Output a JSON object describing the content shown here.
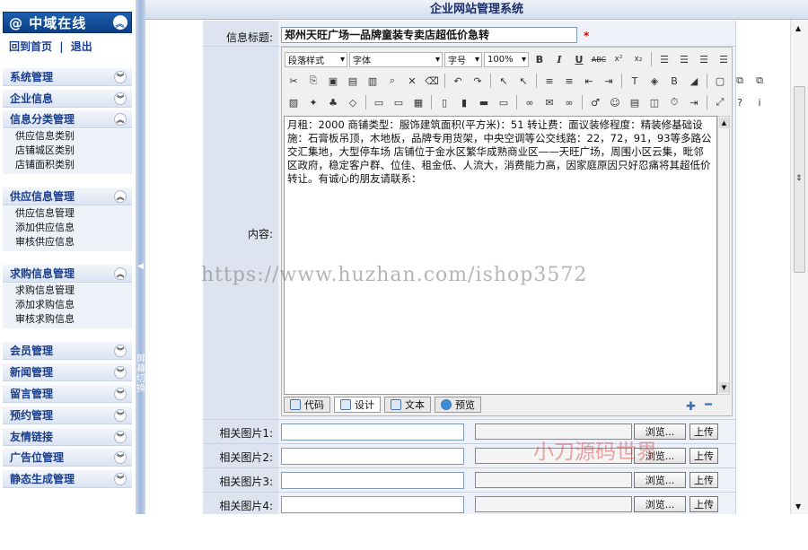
{
  "sidebar": {
    "brand": "@ 中域在线",
    "links": {
      "home": "回到首页",
      "sep": "|",
      "logout": "退出"
    },
    "menus": [
      {
        "label": "系统管理"
      },
      {
        "label": "企业信息"
      },
      {
        "label": "信息分类管理",
        "items": [
          "供应信息类别",
          "店铺城区类别",
          "店铺面积类别"
        ]
      },
      {
        "label": "供应信息管理",
        "items": [
          "供应信息管理",
          "添加供应信息",
          "审核供应信息"
        ]
      },
      {
        "label": "求购信息管理",
        "items": [
          "求购信息管理",
          "添加求购信息",
          "审核求购信息"
        ]
      },
      {
        "label": "会员管理"
      },
      {
        "label": "新闻管理"
      },
      {
        "label": "留言管理"
      },
      {
        "label": "预约管理"
      },
      {
        "label": "友情链接"
      },
      {
        "label": "广告位管理"
      },
      {
        "label": "静态生成管理"
      }
    ],
    "split_text": "屏幕切换"
  },
  "header": {
    "title": "企业网站管理系统"
  },
  "form": {
    "title_label": "信息标题:",
    "title_value": "郑州天旺广场一品牌童装专卖店超低价急转",
    "required_mark": "*",
    "content_label": "内容:",
    "content_text": "月租：2000 商铺类型：服饰建筑面积(平方米)：51 转让费：面议装修程度：精装修基础设施：石膏板吊顶，木地板，品牌专用货架，中央空调等公交线路：22，72，91，93等多路公交汇集地，大型停车场 店铺位于金水区繁华成熟商业区——天旺广场，周围小区云集，毗邻区政府，稳定客户群、位佳、租金低、人流大，消费能力高，因家庭原因只好忍痛将其超低价转让。有诚心的朋友请联系：",
    "toolbar": {
      "paragraph_style": "段落样式",
      "font": "字体",
      "font_size": "字号",
      "zoom": "100%"
    },
    "tabs": [
      "代码",
      "设计",
      "文本",
      "预览"
    ],
    "pictures": [
      {
        "label": "相关图片1:",
        "browse": "浏览...",
        "upload": "上传"
      },
      {
        "label": "相关图片2:",
        "browse": "浏览...",
        "upload": "上传"
      },
      {
        "label": "相关图片3:",
        "browse": "浏览...",
        "upload": "上传"
      },
      {
        "label": "相关图片4:",
        "browse": "浏览...",
        "upload": "上传"
      }
    ]
  },
  "watermark": "https://www.huzhan.com/ishop3572",
  "signature": "小刀源码世界"
}
